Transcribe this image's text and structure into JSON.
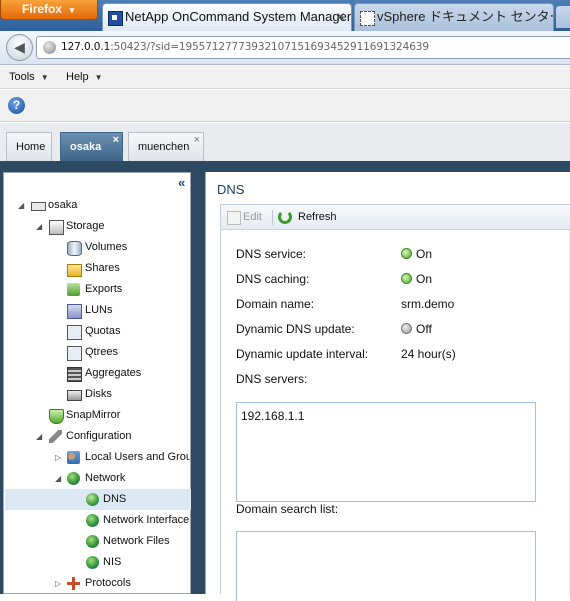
{
  "browser": {
    "app_button": "Firefox",
    "tabs": [
      {
        "label": "NetApp OnCommand System Manager",
        "active": true
      },
      {
        "label": "vSphere ドキュメント センター",
        "active": false
      }
    ],
    "url_host": "127.0.0.1",
    "url_rest": ":50423/?sid=195571277739321071516934529116913246​39"
  },
  "menu": {
    "tools": "Tools",
    "help": "Help"
  },
  "app_tabs": {
    "home": "Home",
    "osaka": "osaka",
    "muenchen": "muenchen",
    "close": "×"
  },
  "tree": {
    "root": "osaka",
    "storage": "Storage",
    "volumes": "Volumes",
    "shares": "Shares",
    "exports": "Exports",
    "luns": "LUNs",
    "quotas": "Quotas",
    "qtrees": "Qtrees",
    "aggregates": "Aggregates",
    "disks": "Disks",
    "snapmirror": "SnapMirror",
    "configuration": "Configuration",
    "local_users": "Local Users and Grou",
    "network": "Network",
    "dns": "DNS",
    "network_interfaces": "Network Interface",
    "network_files": "Network Files",
    "nis": "NIS",
    "protocols": "Protocols"
  },
  "detail": {
    "title": "DNS",
    "toolbar": {
      "edit": "Edit",
      "refresh": "Refresh"
    },
    "fields": {
      "dns_service_label": "DNS service:",
      "dns_service_value": "On",
      "dns_caching_label": "DNS caching:",
      "dns_caching_value": "On",
      "domain_name_label": "Domain name:",
      "domain_name_value": "srm.demo",
      "dynamic_dns_label": "Dynamic DNS update:",
      "dynamic_dns_value": "Off",
      "dynamic_interval_label": "Dynamic update interval:",
      "dynamic_interval_value": "24 hour(s)",
      "dns_servers_label": "DNS servers:",
      "domain_search_label": "Domain search list:"
    },
    "dns_servers": [
      "192.168.1.1"
    ],
    "domain_search_list": []
  },
  "colors": {
    "app_background": "#2e4a63",
    "active_tab": "#3d6587",
    "status_on": "#4ea82b",
    "status_off": "#999999"
  },
  "icons": {
    "firefox_menu": "chevron-down-icon",
    "browser_tab_1": "netapp-icon",
    "browser_tab_2": "page-icon",
    "help": "help-icon",
    "tree_collapse": "double-chevron-left-icon",
    "refresh": "refresh-icon",
    "edit": "edit-icon"
  }
}
